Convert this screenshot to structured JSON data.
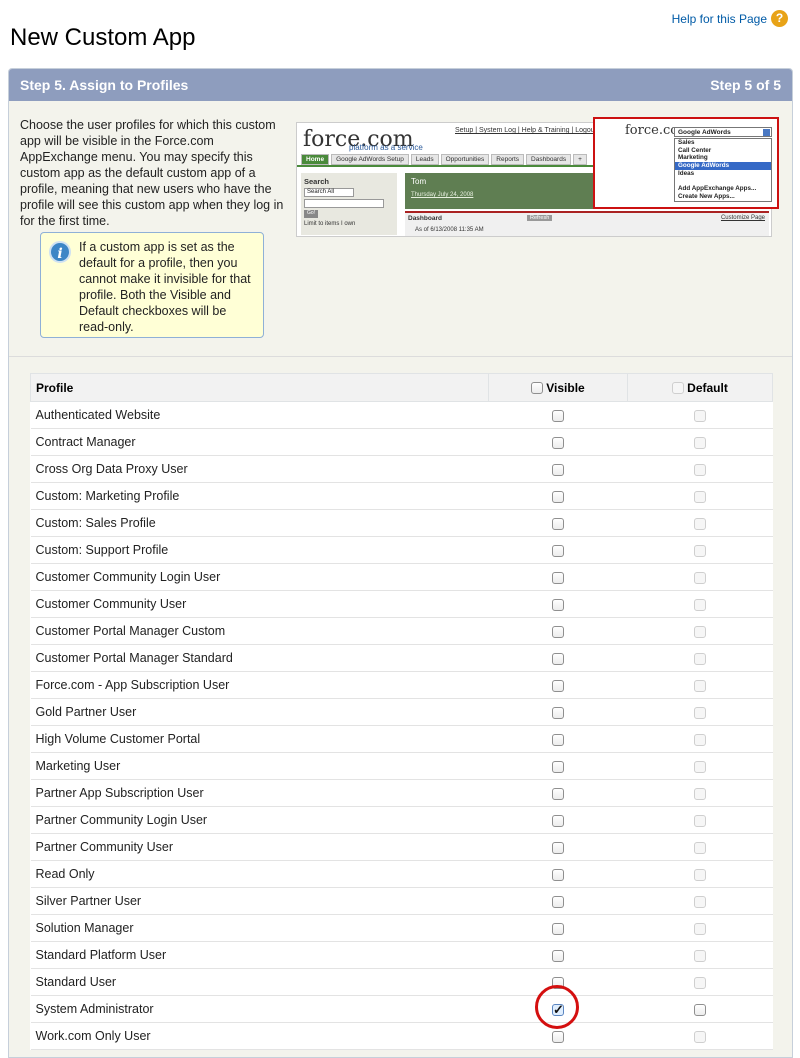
{
  "header": {
    "title": "New Custom App",
    "help_label": "Help for this Page",
    "help_icon": "?"
  },
  "step": {
    "title": "Step 5. Assign to Profiles",
    "counter": "Step 5 of 5"
  },
  "intro_text": "Choose the user profiles for which this custom app will be visible in the Force.com AppExchange menu. You may specify this custom app as the default custom app of a profile, meaning that new users who have the profile will see this custom app when they log in for the first time.",
  "info": {
    "icon": "i",
    "text": "If a custom app is set as the default for a profile, then you cannot make it invisible for that profile. Both the Visible and Default checkboxes will be read-only."
  },
  "preview": {
    "logo": "force.com",
    "logo_sub": "platform as a service",
    "top_links": "Setup | System Log | Help & Training | Logout",
    "tabs": [
      "Home",
      "Google AdWords Setup",
      "Leads",
      "Opportunities",
      "Reports",
      "Dashboards",
      "+"
    ],
    "search_title": "Search",
    "search_select": "Search All",
    "go_label": "Go!",
    "limit_label": "Limit to items I own",
    "banner_name": "Tom",
    "banner_date": "Thursday July 24, 2008",
    "dashboard_label": "Dashboard",
    "refresh_label": "Refresh",
    "customize_label": "Customize Page",
    "as_of": "As of 6/13/2008 11:35 AM",
    "menu_logo": "force.com",
    "menu_selected": "Google AdWords",
    "menu_items": [
      "Sales",
      "Call Center",
      "Marketing",
      "Google AdWords",
      "Ideas",
      "",
      "Add AppExchange Apps...",
      "Create New Apps..."
    ]
  },
  "table": {
    "columns": [
      "Profile",
      "Visible",
      "Default"
    ],
    "rows": [
      {
        "profile": "Authenticated Website",
        "visible": false,
        "default_enabled": false
      },
      {
        "profile": "Contract Manager",
        "visible": false,
        "default_enabled": false
      },
      {
        "profile": "Cross Org Data Proxy User",
        "visible": false,
        "default_enabled": false
      },
      {
        "profile": "Custom: Marketing Profile",
        "visible": false,
        "default_enabled": false
      },
      {
        "profile": "Custom: Sales Profile",
        "visible": false,
        "default_enabled": false
      },
      {
        "profile": "Custom: Support Profile",
        "visible": false,
        "default_enabled": false
      },
      {
        "profile": "Customer Community Login User",
        "visible": false,
        "default_enabled": false
      },
      {
        "profile": "Customer Community User",
        "visible": false,
        "default_enabled": false
      },
      {
        "profile": "Customer Portal Manager Custom",
        "visible": false,
        "default_enabled": false
      },
      {
        "profile": "Customer Portal Manager Standard",
        "visible": false,
        "default_enabled": false
      },
      {
        "profile": "Force.com - App Subscription User",
        "visible": false,
        "default_enabled": false
      },
      {
        "profile": "Gold Partner User",
        "visible": false,
        "default_enabled": false
      },
      {
        "profile": "High Volume Customer Portal",
        "visible": false,
        "default_enabled": false
      },
      {
        "profile": "Marketing User",
        "visible": false,
        "default_enabled": false
      },
      {
        "profile": "Partner App Subscription User",
        "visible": false,
        "default_enabled": false
      },
      {
        "profile": "Partner Community Login User",
        "visible": false,
        "default_enabled": false
      },
      {
        "profile": "Partner Community User",
        "visible": false,
        "default_enabled": false
      },
      {
        "profile": "Read Only",
        "visible": false,
        "default_enabled": false
      },
      {
        "profile": "Silver Partner User",
        "visible": false,
        "default_enabled": false
      },
      {
        "profile": "Solution Manager",
        "visible": false,
        "default_enabled": false
      },
      {
        "profile": "Standard Platform User",
        "visible": false,
        "default_enabled": false
      },
      {
        "profile": "Standard User",
        "visible": false,
        "default_enabled": false
      },
      {
        "profile": "System Administrator",
        "visible": true,
        "default_enabled": true
      },
      {
        "profile": "Work.com Only User",
        "visible": false,
        "default_enabled": false
      }
    ]
  }
}
